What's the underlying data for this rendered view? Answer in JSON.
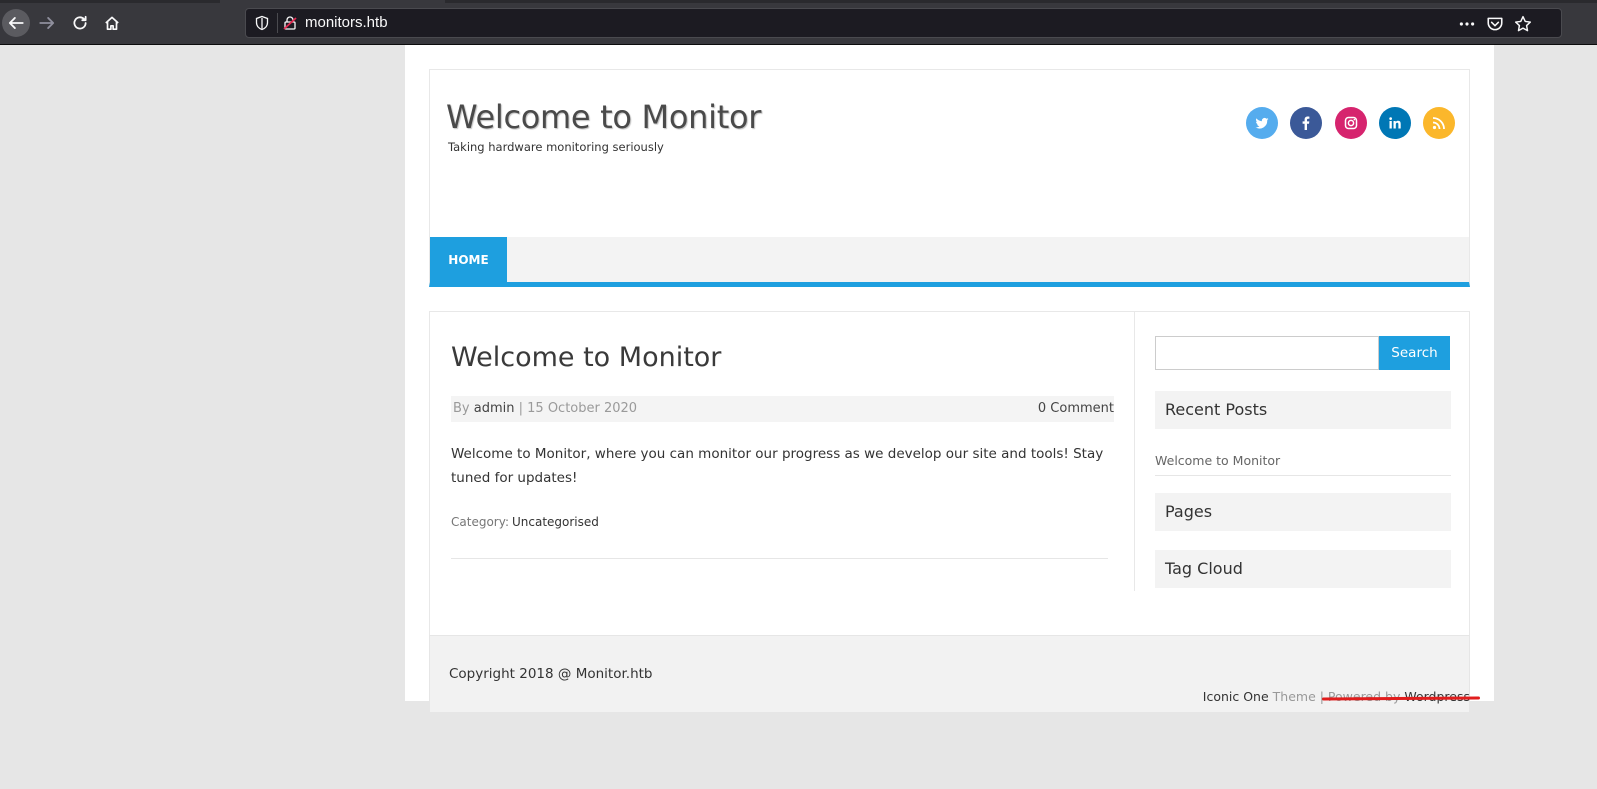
{
  "browser": {
    "url": "monitors.htb"
  },
  "site": {
    "title": "Welcome to Monitor",
    "tagline": "Taking hardware monitoring seriously",
    "social": [
      {
        "name": "twitter-icon",
        "color": "#55acee"
      },
      {
        "name": "facebook-icon",
        "color": "#3b5998"
      },
      {
        "name": "instagram-icon",
        "color": "#d6246e"
      },
      {
        "name": "linkedin-icon",
        "color": "#0077b5"
      },
      {
        "name": "rss-icon",
        "color": "#fbb72b"
      }
    ]
  },
  "nav": {
    "home": "HOME"
  },
  "post": {
    "title": "Welcome to Monitor",
    "by": "By",
    "author": "admin",
    "date_sep": " | 15 October 2020",
    "comments": "0 Comment",
    "body": "Welcome to Monitor, where you can monitor our progress as we develop our site and tools! Stay tuned for updates!",
    "category_label": "Category:",
    "category": "Uncategorised"
  },
  "sidebar": {
    "search_button": "Search",
    "search_value": "",
    "widgets": {
      "recent_posts": "Recent Posts",
      "recent_item": "Welcome to Monitor",
      "pages": "Pages",
      "tag_cloud": "Tag Cloud"
    }
  },
  "footer": {
    "copyright": "Copyright 2018 @ Monitor.htb",
    "theme_name": "Iconic One",
    "theme_word": " Theme | Powered by ",
    "powered": "Wordpress"
  },
  "colors": {
    "accent": "#1e9fdf",
    "annotation": "#e11d1d"
  }
}
